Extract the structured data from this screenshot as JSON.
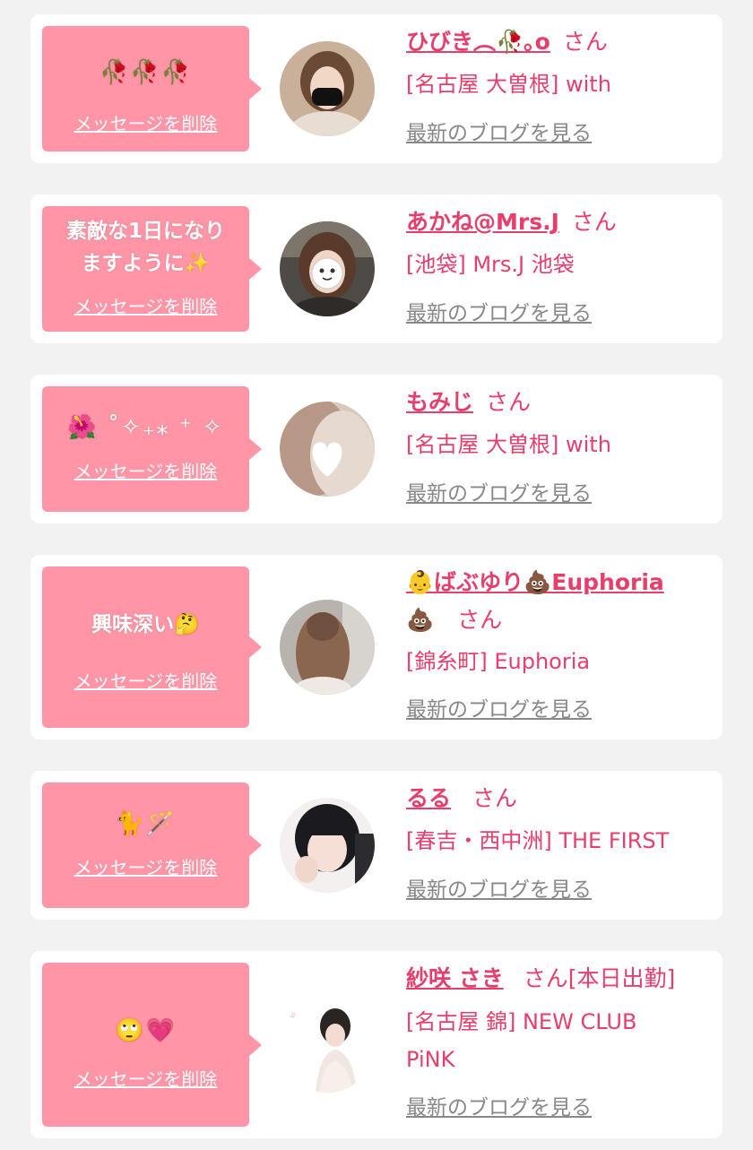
{
  "delete_label": "メッセージを削除",
  "blog_label": "最新のブログを見る",
  "honorific": "さん",
  "cards": [
    {
      "message": "🥀🥀🥀",
      "name": "ひびき︵🥀｡o",
      "extra": "",
      "shop": "[名古屋 大曽根] with"
    },
    {
      "message_line1": "素敵な1日になり",
      "message_line2": "ますように✨",
      "name": "あかね@Mrs.J",
      "extra": "",
      "shop": "[池袋] Mrs.J 池袋"
    },
    {
      "message": "🌺 ˚✧₊⁎ ⁺ ✧",
      "name": "もみじ",
      "extra": "",
      "shop": "[名古屋 大曽根] with"
    },
    {
      "message": "興味深い🤔",
      "name": "👶ばぶゆり💩Euphoria",
      "name_line2": "💩",
      "extra": "",
      "shop": "[錦糸町] Euphoria"
    },
    {
      "message": "🐈🪄",
      "name": "るる",
      "extra": "",
      "shop": "[春吉・西中洲] THE FIRST"
    },
    {
      "message": "🙄💗",
      "name": "紗咲 さき",
      "extra": "[本日出勤]",
      "shop_line1": "[名古屋 錦] NEW CLUB",
      "shop_line2": "PiNK"
    }
  ]
}
